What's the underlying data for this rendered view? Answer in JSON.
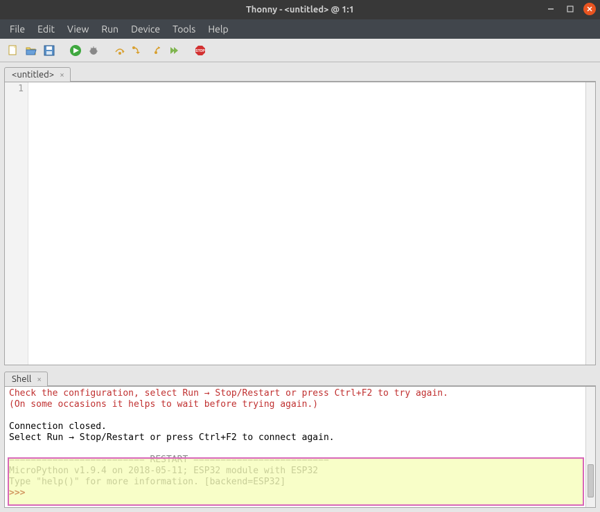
{
  "window": {
    "title": "Thonny  -  <untitled>  @  1:1"
  },
  "menu": {
    "file": "File",
    "edit": "Edit",
    "view": "View",
    "run": "Run",
    "device": "Device",
    "tools": "Tools",
    "help": "Help"
  },
  "editor": {
    "tab_label": "<untitled>",
    "line1_number": "1"
  },
  "shell": {
    "tab_label": "Shell",
    "line_err1": "Check the configuration, select Run → Stop/Restart or press Ctrl+F2 to try again.",
    "line_err2": "(On some occasions it helps to wait before trying again.)",
    "line_blank1": "",
    "line_closed": "Connection closed.",
    "line_select": "Select Run → Stop/Restart or press Ctrl+F2 to connect again.",
    "line_blank2": "",
    "line_restart": "========================= RESTART =========================",
    "line_mp1": "MicroPython v1.9.4 on 2018-05-11; ESP32 module with ESP32",
    "line_mp2": "Type \"help()\" for more information. [backend=ESP32]",
    "prompt": ">>> "
  }
}
